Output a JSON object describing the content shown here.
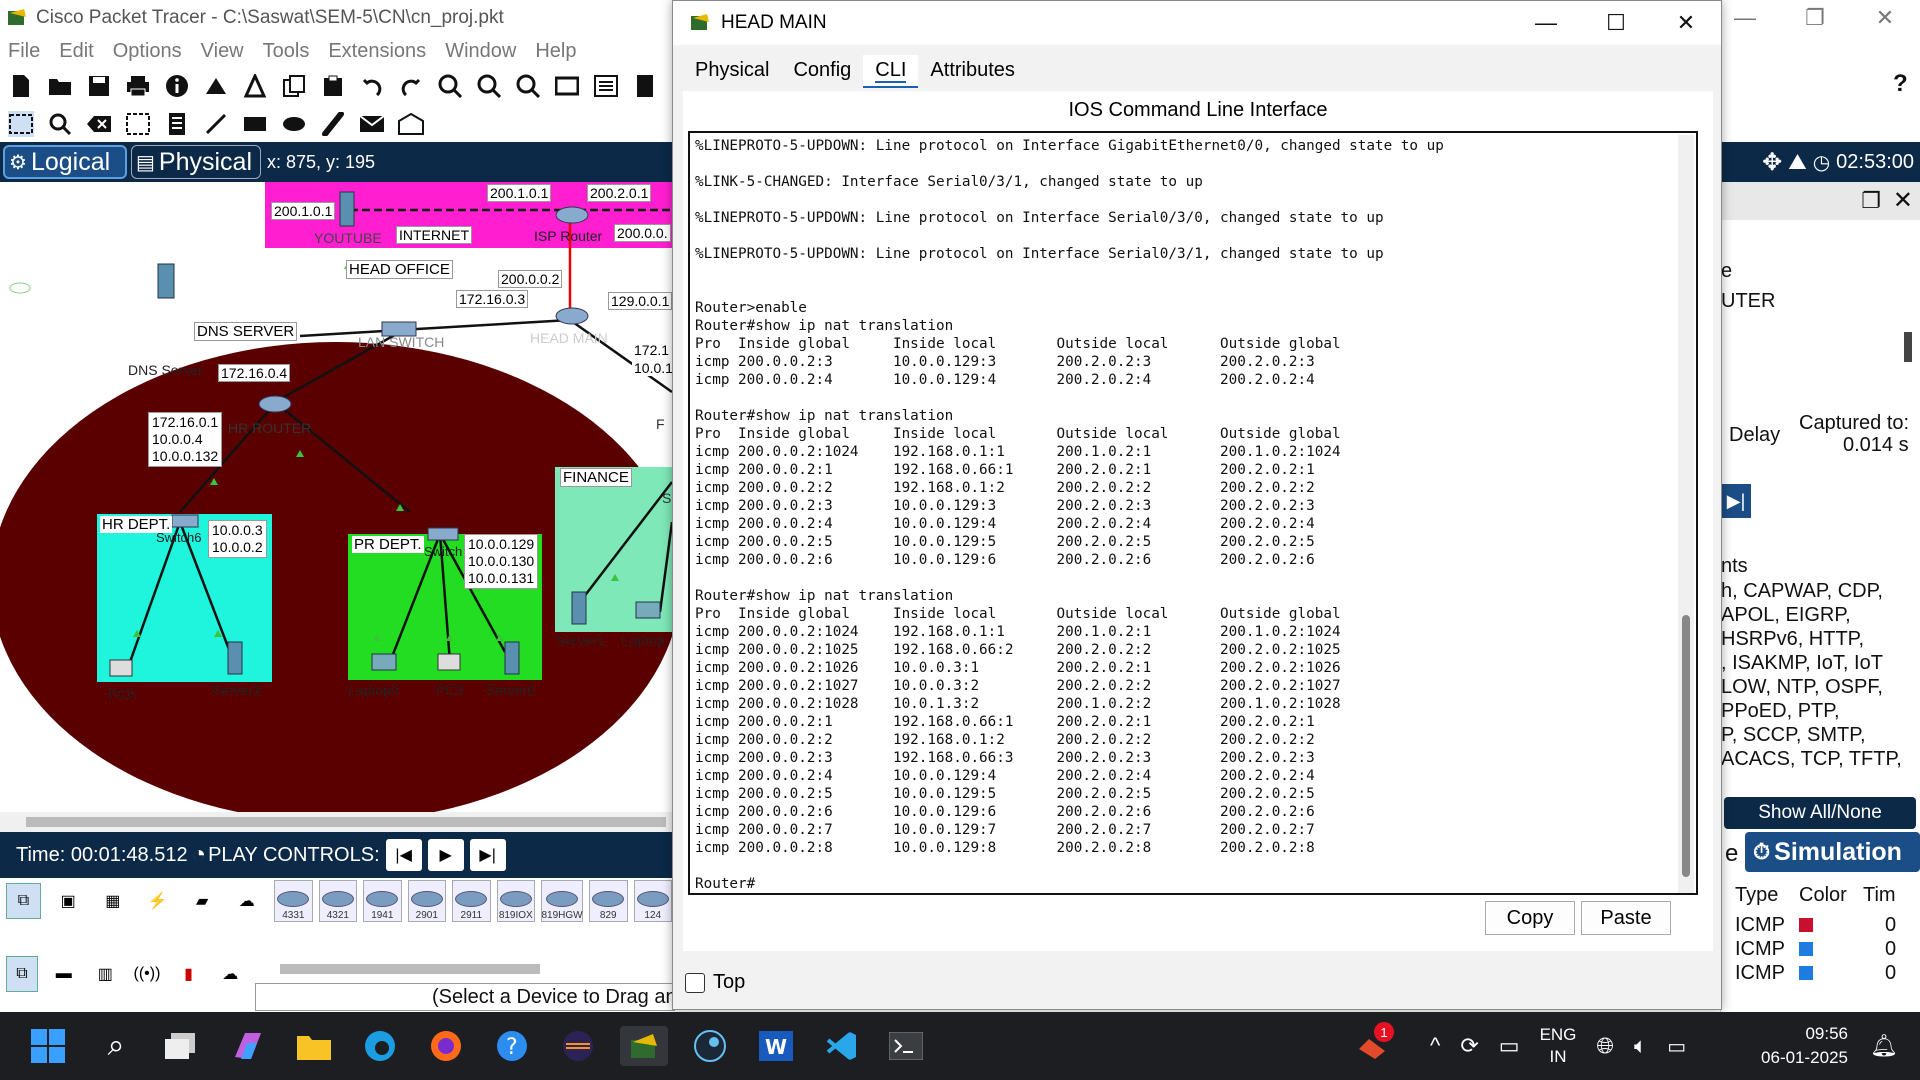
{
  "app": {
    "title": "Cisco Packet Tracer - C:\\Saswat\\SEM-5\\CN\\cn_proj.pkt",
    "menus": [
      "File",
      "Edit",
      "Options",
      "View",
      "Tools",
      "Extensions",
      "Window",
      "Help"
    ],
    "help_glyph": "?"
  },
  "modebar": {
    "logical": "Logical",
    "physical": "Physical",
    "coords": "x: 875, y: 195",
    "clock": "02:53:00"
  },
  "topology": {
    "labels": {
      "isp_ip1": "200.1.0.1",
      "isp_ip2": "200.2.0.1",
      "youtube_ip": "200.1.0.1",
      "youtube": "YOUTUBE",
      "internet": "INTERNET",
      "isp_router": "ISP Router",
      "isp_ip3": "200.0.0.",
      "head_office": "HEAD OFFICE",
      "ip_200002": "200.0.0.2",
      "ip_172163": "172.16.0.3",
      "ip_129001": "129.0.0.1",
      "head_main": "HEAD MAIN",
      "dns_server_box": "DNS SERVER",
      "dns_server": "DNS Server",
      "dns_ip": "172.16.0.4",
      "lan_switch": "LAN SWITCH",
      "ip_172_1": "172.1",
      "ip_10_0_1": "10.0.1",
      "hr_router_ips": [
        "172.16.0.1",
        "10.0.0.4",
        "10.0.0.132"
      ],
      "hr_router": "HR ROUTER",
      "finance": "FINANCE",
      "hr_dept": "HR DEPT.",
      "switch6": "Switch6",
      "hr_ips": [
        "10.0.0.3",
        "10.0.0.2"
      ],
      "pr_dept": "PR DEPT.",
      "pr_switch": "Switch",
      "pr_ips": [
        "10.0.0.129",
        "10.0.0.130",
        "10.0.0.131"
      ],
      "pc0": "PC0",
      "server3": "Server3",
      "laptop0": "Laptop0",
      "pc3": "PC3",
      "server0": "Server0",
      "server1": "Server1",
      "laptop_f": "Laptop",
      "f_label": "F",
      "s_label": "S"
    }
  },
  "timebar": {
    "time": "Time: 00:01:48.512",
    "play_controls": "PLAY CONTROLS:"
  },
  "devices": {
    "routers": [
      "4331",
      "4321",
      "1941",
      "2901",
      "2911",
      "819IOX",
      "819HGW",
      "829",
      "124"
    ],
    "hint": "(Select a Device to Drag and Drop to the Workspace)"
  },
  "right_panel": {
    "l1": "e",
    "l2": "UTER",
    "captured": "Captured to:",
    "captured_val": "0.014 s",
    "delay": "Delay",
    "nts": "nts",
    "protocols": [
      "h, CAPWAP, CDP,",
      "APOL, EIGRP,",
      "HSRPv6, HTTP,",
      ", ISAKMP, IoT, IoT",
      "LOW, NTP, OSPF,",
      "PPoED, PTP,",
      "P, SCCP, SMTP,",
      "ACACS, TCP, TFTP,"
    ],
    "show_all": "Show All/None",
    "sim_prefix": "e",
    "simulation": "Simulation",
    "table_headers": [
      "Type",
      "Color",
      "Tim"
    ],
    "events": [
      {
        "type": "ICMP",
        "color": "#c8102e",
        "time": "0"
      },
      {
        "type": "ICMP",
        "color": "#1e7be0",
        "time": "0"
      },
      {
        "type": "ICMP",
        "color": "#1e7be0",
        "time": "0"
      }
    ]
  },
  "dialog": {
    "title": "HEAD MAIN",
    "tabs": [
      "Physical",
      "Config",
      "CLI",
      "Attributes"
    ],
    "active_tab": "CLI",
    "cli_title": "IOS Command Line Interface",
    "cli_lines": [
      "%LINEPROTO-5-UPDOWN: Line protocol on Interface GigabitEthernet0/0, changed state to up",
      "",
      "%LINK-5-CHANGED: Interface Serial0/3/1, changed state to up",
      "",
      "%LINEPROTO-5-UPDOWN: Line protocol on Interface Serial0/3/0, changed state to up",
      "",
      "%LINEPROTO-5-UPDOWN: Line protocol on Interface Serial0/3/1, changed state to up",
      "",
      "",
      "Router>enable",
      "Router#show ip nat translation",
      "Pro  Inside global     Inside local       Outside local      Outside global",
      "icmp 200.0.0.2:3       10.0.0.129:3       200.2.0.2:3        200.2.0.2:3",
      "icmp 200.0.0.2:4       10.0.0.129:4       200.2.0.2:4        200.2.0.2:4",
      "",
      "Router#show ip nat translation",
      "Pro  Inside global     Inside local       Outside local      Outside global",
      "icmp 200.0.0.2:1024    192.168.0.1:1      200.1.0.2:1        200.1.0.2:1024",
      "icmp 200.0.0.2:1       192.168.0.66:1     200.2.0.2:1        200.2.0.2:1",
      "icmp 200.0.0.2:2       192.168.0.1:2      200.2.0.2:2        200.2.0.2:2",
      "icmp 200.0.0.2:3       10.0.0.129:3       200.2.0.2:3        200.2.0.2:3",
      "icmp 200.0.0.2:4       10.0.0.129:4       200.2.0.2:4        200.2.0.2:4",
      "icmp 200.0.0.2:5       10.0.0.129:5       200.2.0.2:5        200.2.0.2:5",
      "icmp 200.0.0.2:6       10.0.0.129:6       200.2.0.2:6        200.2.0.2:6",
      "",
      "Router#show ip nat translation",
      "Pro  Inside global     Inside local       Outside local      Outside global",
      "icmp 200.0.0.2:1024    192.168.0.1:1      200.1.0.2:1        200.1.0.2:1024",
      "icmp 200.0.0.2:1025    192.168.0.66:2     200.2.0.2:2        200.2.0.2:1025",
      "icmp 200.0.0.2:1026    10.0.0.3:1         200.2.0.2:1        200.2.0.2:1026",
      "icmp 200.0.0.2:1027    10.0.0.3:2         200.2.0.2:2        200.2.0.2:1027",
      "icmp 200.0.0.2:1028    10.0.1.3:2         200.1.0.2:2        200.1.0.2:1028",
      "icmp 200.0.0.2:1       192.168.0.66:1     200.2.0.2:1        200.2.0.2:1",
      "icmp 200.0.0.2:2       192.168.0.1:2      200.2.0.2:2        200.2.0.2:2",
      "icmp 200.0.0.2:3       192.168.0.66:3     200.2.0.2:3        200.2.0.2:3",
      "icmp 200.0.0.2:4       10.0.0.129:4       200.2.0.2:4        200.2.0.2:4",
      "icmp 200.0.0.2:5       10.0.0.129:5       200.2.0.2:5        200.2.0.2:5",
      "icmp 200.0.0.2:6       10.0.0.129:6       200.2.0.2:6        200.2.0.2:6",
      "icmp 200.0.0.2:7       10.0.0.129:7       200.2.0.2:7        200.2.0.2:7",
      "icmp 200.0.0.2:8       10.0.0.129:8       200.2.0.2:8        200.2.0.2:8",
      "",
      "Router#"
    ],
    "copy": "Copy",
    "paste": "Paste",
    "top": "Top"
  },
  "taskbar": {
    "lang": "ENG",
    "region": "IN",
    "time": "09:56",
    "date": "06-01-2025",
    "notif_badge": "1",
    "tray_up_glyph": "^"
  }
}
